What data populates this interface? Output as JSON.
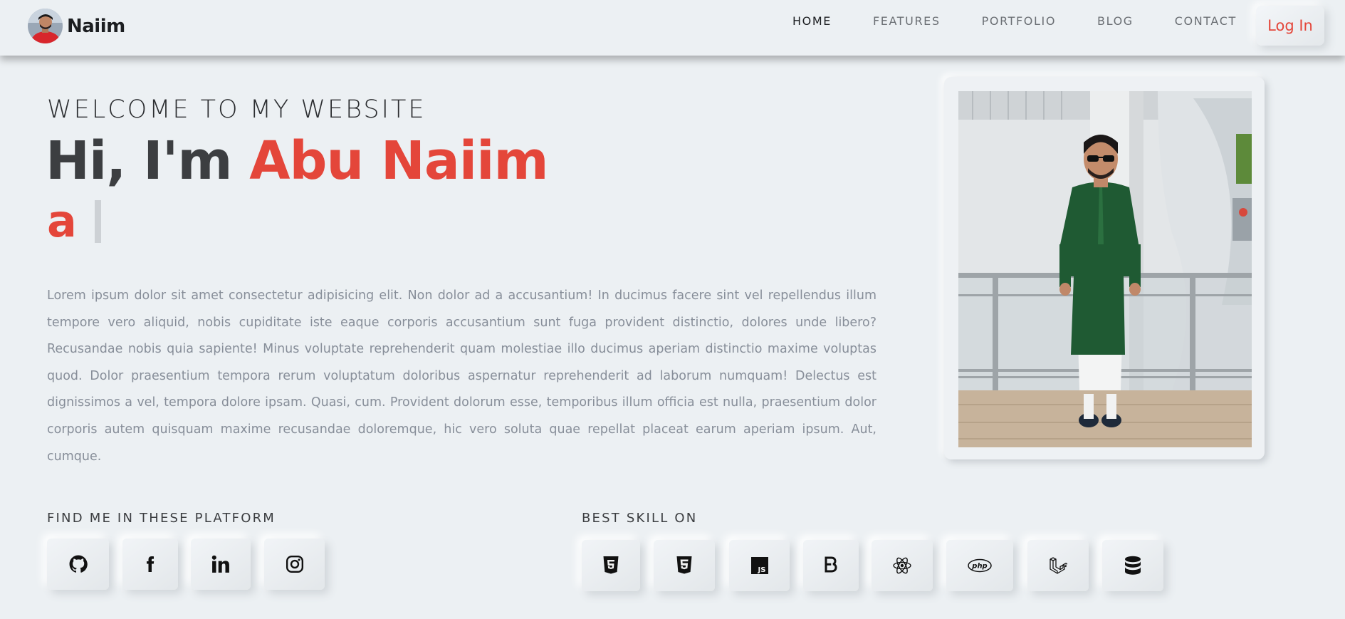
{
  "header": {
    "brand_name": "Naiim",
    "nav": [
      {
        "label": "HOME",
        "active": true
      },
      {
        "label": "FEATURES",
        "active": false
      },
      {
        "label": "PORTFOLIO",
        "active": false
      },
      {
        "label": "BLOG",
        "active": false
      },
      {
        "label": "CONTACT",
        "active": false
      }
    ],
    "login_label": "Log In"
  },
  "hero": {
    "welcome": "WELCOME TO MY WEBSITE",
    "greeting": "Hi, I'm ",
    "name": "Abu Naiim",
    "typed_text": "a",
    "bio": "Lorem ipsum dolor sit amet consectetur adipisicing elit. Non dolor ad a accusantium! In ducimus facere sint vel repellendus illum tempore vero aliquid, nobis cupiditate iste eaque corporis accusantium sunt fuga provident distinctio, dolores unde libero? Recusandae nobis quia sapiente! Minus voluptate reprehenderit quam molestiae illo ducimus aperiam distinctio maxime voluptas quod. Dolor praesentium tempora rerum voluptatum doloribus aspernatur reprehenderit ad laborum numquam! Delectus est dignissimos a vel, tempora dolore ipsam. Quasi, cum. Provident dolorum esse, temporibus illum officia est nulla, praesentium dolor corporis autem quisquam maxime recusandae doloremque, hic vero soluta quae repellat placeat earum aperiam ipsum. Aut, cumque."
  },
  "social": {
    "title": "FIND ME IN THESE PLATFORM",
    "icons": [
      "github-icon",
      "facebook-icon",
      "linkedin-icon",
      "instagram-icon"
    ]
  },
  "skills": {
    "title": "BEST SKILL ON",
    "icons": [
      "html5-icon",
      "css3-icon",
      "javascript-icon",
      "bootstrap-icon",
      "react-icon",
      "php-icon",
      "laravel-icon",
      "database-icon"
    ],
    "php_text": "php",
    "js_text": "JS"
  },
  "colors": {
    "background": "#ecf0f3",
    "accent": "#e4463a",
    "text": "#3c3e41",
    "muted": "#878e99"
  }
}
